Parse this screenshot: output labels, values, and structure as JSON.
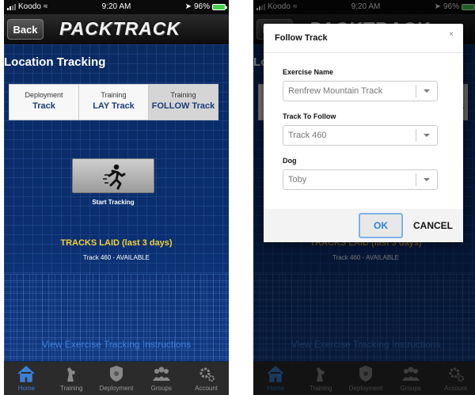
{
  "status_bar": {
    "carrier": "Koodo",
    "time": "9:20 AM",
    "battery": "96%"
  },
  "header": {
    "back_label": "Back",
    "logo_text": "PACKTRACK"
  },
  "page_title": "Location Tracking",
  "tabs": [
    {
      "small": "Deployment",
      "big": "Track"
    },
    {
      "small": "Training",
      "big": "LAY Track"
    },
    {
      "small": "Training",
      "big": "FOLLOW Track"
    }
  ],
  "start_tracking_label": "Start Tracking",
  "tracks_title": "TRACKS LAID (last 3 days)",
  "tracks": [
    "Track 460 - AVAILABLE"
  ],
  "instructions_link": "View Exercise Tracking Instructions",
  "tabbar": [
    {
      "label": "Home",
      "icon": "home-icon"
    },
    {
      "label": "Training",
      "icon": "dog-icon"
    },
    {
      "label": "Deployment",
      "icon": "badge-icon"
    },
    {
      "label": "Groups",
      "icon": "group-icon"
    },
    {
      "label": "Account",
      "icon": "gear-icon"
    }
  ],
  "modal": {
    "title": "Follow Track",
    "close": "×",
    "fields": [
      {
        "label": "Exercise Name",
        "value": "Renfrew Mountain Track"
      },
      {
        "label": "Track To Follow",
        "value": "Track 460"
      },
      {
        "label": "Dog",
        "value": "Toby"
      }
    ],
    "ok_label": "OK",
    "cancel_label": "CANCEL"
  },
  "colors": {
    "accent": "#3d7fd6",
    "gold": "#f0cf3a",
    "navy": "#0b2f70"
  }
}
